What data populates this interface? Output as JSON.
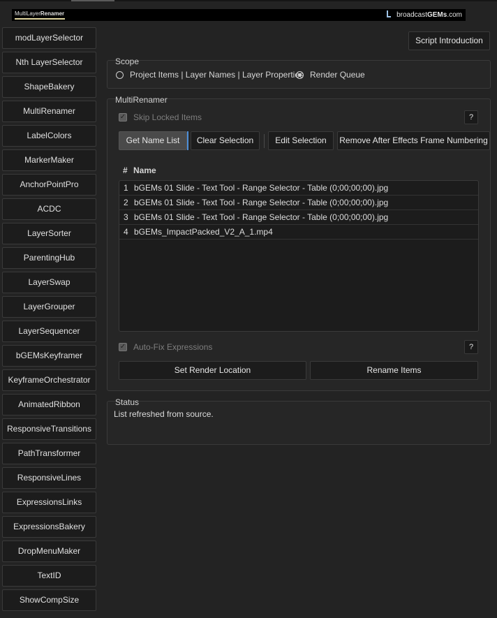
{
  "banner": {
    "title_prefix": "MultiLayer",
    "title_strong": "Renamer",
    "brand_prefix": "broadcast",
    "brand_strong": "GEMs",
    "brand_suffix": ".com"
  },
  "sidebar": {
    "items": [
      {
        "label": "modLayerSelector"
      },
      {
        "label": "Nth LayerSelector"
      },
      {
        "label": "ShapeBakery"
      },
      {
        "label": "MultiRenamer"
      },
      {
        "label": "LabelColors"
      },
      {
        "label": "MarkerMaker"
      },
      {
        "label": "AnchorPointPro"
      },
      {
        "label": "ACDC"
      },
      {
        "label": "LayerSorter"
      },
      {
        "label": "ParentingHub"
      },
      {
        "label": "LayerSwap"
      },
      {
        "label": "LayerGrouper"
      },
      {
        "label": "LayerSequencer"
      },
      {
        "label": "bGEMsKeyframer"
      },
      {
        "label": "KeyframeOrchestrator"
      },
      {
        "label": "AnimatedRibbon"
      },
      {
        "label": "ResponsiveTransitions"
      },
      {
        "label": "PathTransformer"
      },
      {
        "label": "ResponsiveLines"
      },
      {
        "label": "ExpressionsLinks"
      },
      {
        "label": "ExpressionsBakery"
      },
      {
        "label": "DropMenuMaker"
      },
      {
        "label": "TextID"
      },
      {
        "label": "ShowCompSize"
      }
    ]
  },
  "intro_button": "Script Introduction",
  "scope": {
    "title": "Scope",
    "option_project": "Project Items | Layer Names | Layer Properties",
    "option_render": "Render Queue",
    "selected": "Render Queue"
  },
  "renamer": {
    "title": "MultiRenamer",
    "skip_locked": "Skip Locked Items",
    "skip_locked_checked": true,
    "help_label": "?",
    "btn_get": "Get Name List",
    "btn_clear": "Clear Selection",
    "btn_edit": "Edit Selection",
    "btn_remove": "Remove After Effects Frame Numbering",
    "col_hash": "#",
    "col_name": "Name",
    "rows": [
      {
        "n": "1",
        "name": "bGEMs 01 Slide - Text Tool - Range Selector - Table (0;00;00;00).jpg"
      },
      {
        "n": "2",
        "name": "bGEMs 01 Slide - Text Tool - Range Selector - Table (0;00;00;00).jpg"
      },
      {
        "n": "3",
        "name": "bGEMs 01 Slide - Text Tool - Range Selector - Table (0;00;00;00).jpg"
      },
      {
        "n": "4",
        "name": "bGEMs_ImpactPacked_V2_A_1.mp4"
      }
    ],
    "auto_fix": "Auto-Fix Expressions",
    "auto_fix_checked": true,
    "btn_render_location": "Set Render Location",
    "btn_rename": "Rename Items"
  },
  "status": {
    "title": "Status",
    "text": "List refreshed from source."
  },
  "colors": {
    "background": "#232323",
    "accent_focus": "#4d8ed8",
    "banner_underline": "#e0d6a0"
  }
}
